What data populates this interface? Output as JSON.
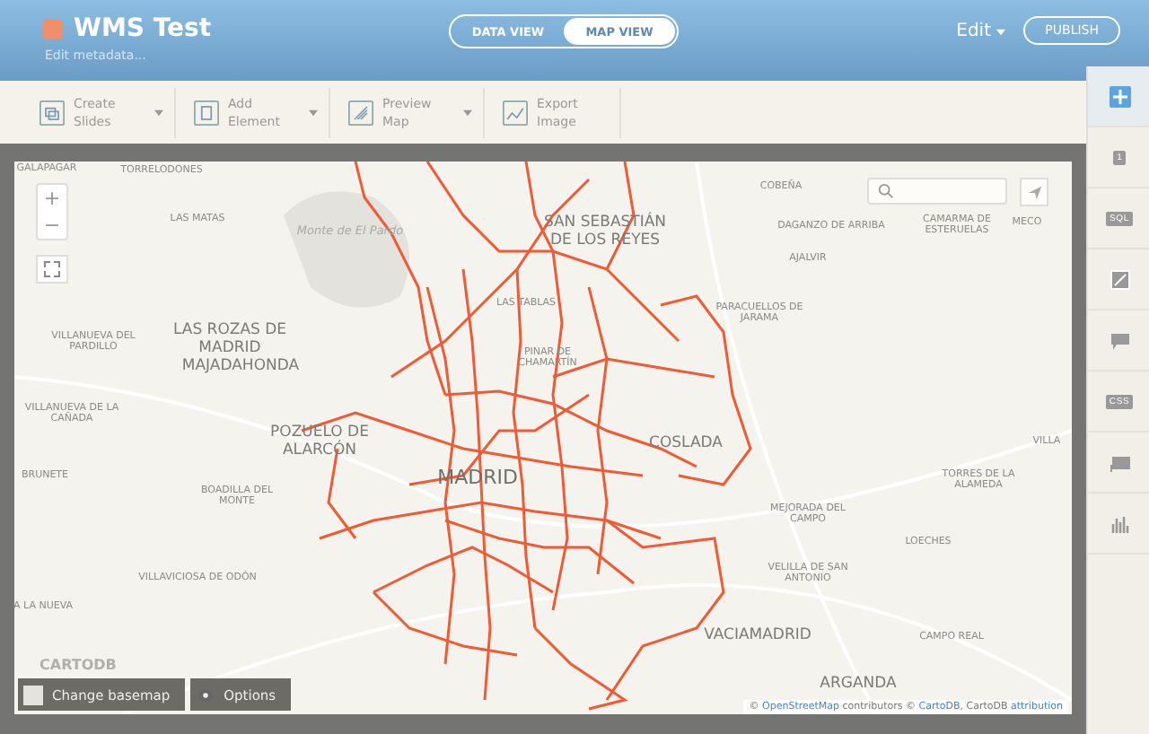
{
  "header": {
    "title": "WMS Test",
    "subtitle": "Edit metadata...",
    "view_toggle": [
      {
        "label": "DATA VIEW",
        "selected": false
      },
      {
        "label": "MAP VIEW",
        "selected": true
      }
    ],
    "edit_menu": "Edit",
    "publish_button": "PUBLISH"
  },
  "toolbar": [
    {
      "label": "Create Slides",
      "has_menu": true,
      "kind": "slides"
    },
    {
      "label": "Add Element",
      "has_menu": true,
      "kind": "element"
    },
    {
      "label": "Preview Map",
      "has_menu": true,
      "kind": "preview"
    },
    {
      "label": "Export Image",
      "has_menu": false,
      "kind": "image"
    }
  ],
  "map": {
    "zoom_controls": [
      "+",
      "−"
    ],
    "labels": [
      {
        "text": "GALAPAGAR",
        "kind": "small"
      },
      {
        "text": "TORRELODONES",
        "kind": "small"
      },
      {
        "text": "LAS MATAS",
        "kind": "small"
      },
      {
        "text": "Monte de El Pardo",
        "kind": "area"
      },
      {
        "text": "LAS ROZAS DE MADRID",
        "kind": "large"
      },
      {
        "text": "MAJADAHONDA",
        "kind": "large"
      },
      {
        "text": "VILLANUEVA DEL PARDILLO",
        "kind": "small"
      },
      {
        "text": "VILLANUEVA DE LA CAÑADA",
        "kind": "small"
      },
      {
        "text": "POZUELO DE ALARCÓN",
        "kind": "large"
      },
      {
        "text": "BRUNETE",
        "kind": "small"
      },
      {
        "text": "BOADILLA DEL MONTE",
        "kind": "small"
      },
      {
        "text": "VILLAVICIOSA DE ODÓN",
        "kind": "small"
      },
      {
        "text": "A LA NUEVA",
        "kind": "small"
      },
      {
        "text": "MADRID",
        "kind": "capital"
      },
      {
        "text": "LAS TABLAS",
        "kind": "small"
      },
      {
        "text": "PINAR DE CHAMARTÍN",
        "kind": "small"
      },
      {
        "text": "SAN SEBASTIÁN DE LOS REYES",
        "kind": "large"
      },
      {
        "text": "COBEÑA",
        "kind": "small"
      },
      {
        "text": "DAGANZO DE ARRIBA",
        "kind": "small"
      },
      {
        "text": "CAMARMA DE ESTERUELAS",
        "kind": "small"
      },
      {
        "text": "MECO",
        "kind": "small"
      },
      {
        "text": "AJALVIR",
        "kind": "small"
      },
      {
        "text": "PARACUELLOS DE JARAMA",
        "kind": "small"
      },
      {
        "text": "COSLADA",
        "kind": "large"
      },
      {
        "text": "VILLA",
        "kind": "small"
      },
      {
        "text": "TORRES DE LA ALAMEDA",
        "kind": "small"
      },
      {
        "text": "MEJORADA DEL CAMPO",
        "kind": "small"
      },
      {
        "text": "LOECHES",
        "kind": "small"
      },
      {
        "text": "VELILLA DE SAN ANTONIO",
        "kind": "small"
      },
      {
        "text": "VACIAMADRID",
        "kind": "large"
      },
      {
        "text": "CAMPO REAL",
        "kind": "small"
      },
      {
        "text": "ARGANDA",
        "kind": "large"
      }
    ],
    "logo": "CARTODB",
    "bottom_buttons": [
      {
        "label": "Change basemap",
        "kind": "basemap"
      },
      {
        "label": "Options",
        "kind": "options"
      }
    ],
    "attribution": [
      {
        "text": "© ",
        "link": false
      },
      {
        "text": "OpenStreetMap",
        "link": true
      },
      {
        "text": " contributors © ",
        "link": false
      },
      {
        "text": "CartoDB",
        "link": true
      },
      {
        "text": ", CartoDB ",
        "link": false
      },
      {
        "text": "attribution",
        "link": true
      }
    ]
  },
  "sidebar": [
    {
      "kind": "add",
      "selected": true
    },
    {
      "kind": "layer",
      "label": "1",
      "selected": false
    },
    {
      "kind": "sql",
      "label": "SQL",
      "selected": false
    },
    {
      "kind": "wizard",
      "selected": false
    },
    {
      "kind": "infowindow",
      "selected": false
    },
    {
      "kind": "css",
      "label": "CSS",
      "selected": false
    },
    {
      "kind": "legend",
      "selected": false
    },
    {
      "kind": "widgets",
      "selected": false
    }
  ]
}
